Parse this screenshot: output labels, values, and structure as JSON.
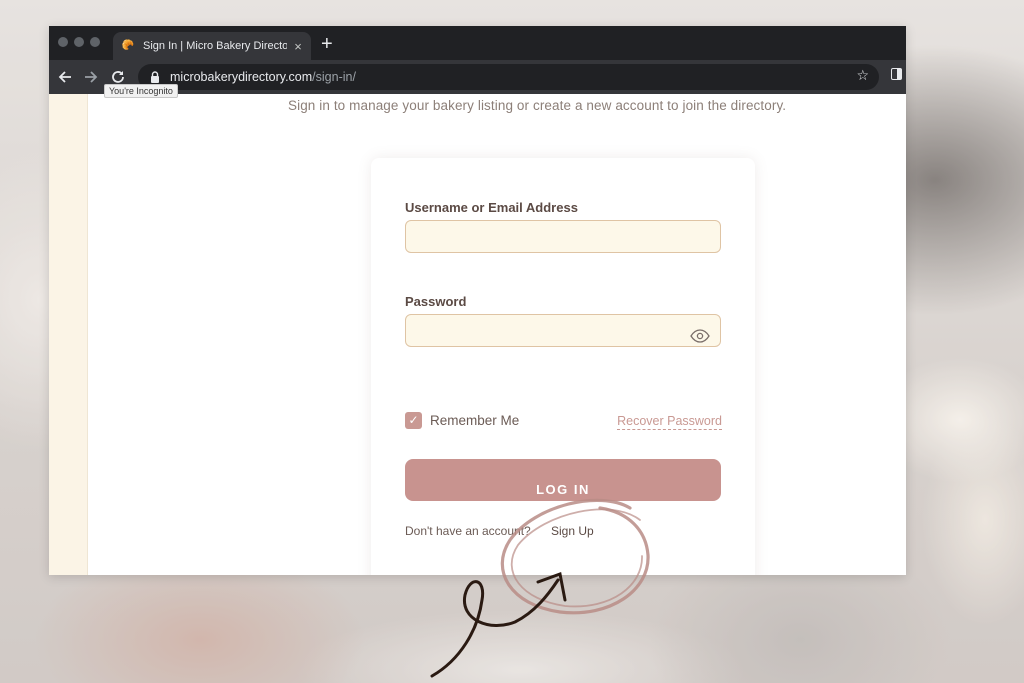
{
  "browser": {
    "tab_title": "Sign In | Micro Bakery Directory",
    "tab_close": "×",
    "new_tab": "+",
    "url_host": "microbakerydirectory.com",
    "url_path": "/sign-in/",
    "tooltip": "You're Incognito",
    "icons": {
      "back": "arrow-left-icon",
      "forward": "arrow-right-icon",
      "reload": "reload-icon",
      "lock": "lock-icon",
      "star": "star-icon",
      "side_panel": "side-panel-icon"
    }
  },
  "page": {
    "subtitle": "Sign in to manage your bakery listing or create a new account to join the directory.",
    "form": {
      "username_label": "Username or Email Address",
      "username_value": "",
      "password_label": "Password",
      "password_value": "",
      "remember_label": "Remember Me",
      "remember_checked": true,
      "recover_link": "Recover Password",
      "login_button": "LOG IN",
      "no_account_text": "Don't have an account?",
      "signup_link": "Sign Up"
    }
  },
  "colors": {
    "accent": "#c8938f",
    "field_bg": "#fdf8e9",
    "field_border": "#dfc4a4",
    "text": "#5b4a44",
    "annotation": "#2a1a12"
  }
}
